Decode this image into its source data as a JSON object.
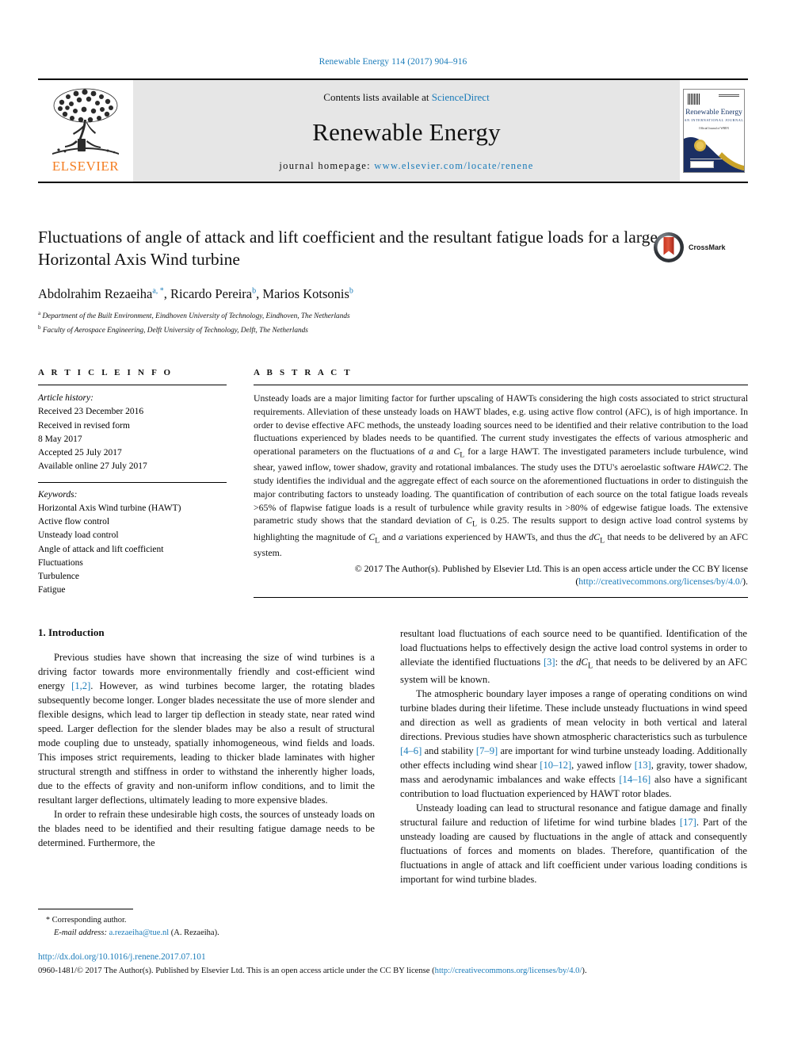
{
  "running_head": "Renewable Energy 114 (2017) 904–916",
  "masthead": {
    "contents_prefix": "Contents lists available at ",
    "contents_link": "ScienceDirect",
    "journal_name": "Renewable Energy",
    "homepage_prefix": "journal homepage: ",
    "homepage_url": "www.elsevier.com/locate/renene",
    "publisher": "ELSEVIER",
    "cover": {
      "title": "Renewable Energy",
      "subtitle": "AN INTERNATIONAL JOURNAL",
      "line3": "Official Journal of WREN"
    }
  },
  "article": {
    "title": "Fluctuations of angle of attack and lift coefficient and the resultant fatigue loads for a large Horizontal Axis Wind turbine",
    "authors": [
      {
        "name": "Abdolrahim Rezaeiha",
        "marks": "a, *"
      },
      {
        "name": "Ricardo Pereira",
        "marks": "b"
      },
      {
        "name": "Marios Kotsonis",
        "marks": "b"
      }
    ],
    "affiliations": [
      {
        "mark": "a",
        "text": "Department of the Built Environment, Eindhoven University of Technology, Eindhoven, The Netherlands"
      },
      {
        "mark": "b",
        "text": "Faculty of Aerospace Engineering, Delft University of Technology, Delft, The Netherlands"
      }
    ],
    "crossmark_label": "CrossMark"
  },
  "article_info": {
    "heading": "A R T I C L E   I N F O",
    "history_title": "Article history:",
    "history": [
      "Received 23 December 2016",
      "Received in revised form",
      "8 May 2017",
      "Accepted 25 July 2017",
      "Available online 27 July 2017"
    ],
    "keywords_title": "Keywords:",
    "keywords": [
      "Horizontal Axis Wind turbine (HAWT)",
      "Active flow control",
      "Unsteady load control",
      "Angle of attack and lift coefficient",
      "Fluctuations",
      "Turbulence",
      "Fatigue"
    ]
  },
  "abstract": {
    "heading": "A B S T R A C T",
    "paragraph_1": "Unsteady loads are a major limiting factor for further upscaling of HAWTs considering the high costs associated to strict structural requirements. Alleviation of these unsteady loads on HAWT blades, e.g. using active flow control (AFC), is of high importance. In order to devise effective AFC methods, the unsteady loading sources need to be identified and their relative contribution to the load fluctuations experienced by blades needs to be quantified. The current study investigates the effects of various atmospheric and operational parameters on the fluctuations of ",
    "frag_alpha": "a",
    "frag_and": " and ",
    "frag_cl": "C",
    "frag_cl_sub": "L",
    "paragraph_2": " for a large HAWT. The investigated parameters include turbulence, wind shear, yawed inflow, tower shadow, gravity and rotational imbalances. The study uses the DTU's aeroelastic software ",
    "frag_hawc2": "HAWC2",
    "paragraph_3": ". The study identifies the individual and the aggregate effect of each source on the aforementioned fluctuations in order to distinguish the major contributing factors to unsteady loading. The quantification of contribution of each source on the total fatigue loads reveals >65% of flapwise fatigue loads is a result of turbulence while gravity results in >80% of edgewise fatigue loads. The extensive parametric study shows that the standard deviation of ",
    "paragraph_4": " is 0.25. The results support to design active load control systems by highlighting the magnitude of ",
    "paragraph_5": " and ",
    "paragraph_6": " variations experienced by HAWTs, and thus the ",
    "frag_dcl": "dC",
    "paragraph_7": " that needs to be delivered by an AFC system.",
    "copyright_prefix": "© 2017 The Author(s). Published by Elsevier Ltd. This is an open access article under the CC BY license ",
    "license_open": "(",
    "license_url": "http://creativecommons.org/licenses/by/4.0/",
    "license_close": ")."
  },
  "introduction": {
    "heading": "1. Introduction",
    "left_paragraphs": [
      "Previous studies have shown that increasing the size of wind turbines is a driving factor towards more environmentally friendly and cost-efficient wind energy [1,2]. However, as wind turbines become larger, the rotating blades subsequently become longer. Longer blades necessitate the use of more slender and flexible designs, which lead to larger tip deflection in steady state, near rated wind speed. Larger deflection for the slender blades may be also a result of structural mode coupling due to unsteady, spatially inhomogeneous, wind fields and loads. This imposes strict requirements, leading to thicker blade laminates with higher structural strength and stiffness in order to withstand the inherently higher loads, due to the effects of gravity and non-uniform inflow conditions, and to limit the resultant larger deflections, ultimately leading to more expensive blades.",
      "In order to refrain these undesirable high costs, the sources of unsteady loads on the blades need to be identified and their resulting fatigue damage needs to be determined. Furthermore, the"
    ],
    "right_paragraphs": [
      "resultant load fluctuations of each source need to be quantified. Identification of the load fluctuations helps to effectively design the active load control systems in order to alleviate the identified fluctuations [3]: the dCL that needs to be delivered by an AFC system will be known.",
      "The atmospheric boundary layer imposes a range of operating conditions on wind turbine blades during their lifetime. These include unsteady fluctuations in wind speed and direction as well as gradients of mean velocity in both vertical and lateral directions. Previous studies have shown atmospheric characteristics such as turbulence [4–6] and stability [7–9] are important for wind turbine unsteady loading. Additionally other effects including wind shear [10–12], yawed inflow [13], gravity, tower shadow, mass and aerodynamic imbalances and wake effects [14–16] also have a significant contribution to load fluctuation experienced by HAWT rotor blades.",
      "Unsteady loading can lead to structural resonance and fatigue damage and finally structural failure and reduction of lifetime for wind turbine blades [17]. Part of the unsteady loading are caused by fluctuations in the angle of attack and consequently fluctuations of forces and moments on blades. Therefore, quantification of the fluctuations in angle of attack and lift coefficient under various loading conditions is important for wind turbine blades."
    ],
    "citations": {
      "c12": "[1,2]",
      "c3": "[3]",
      "c46": "[4–6]",
      "c79": "[7–9]",
      "c1012": "[10–12]",
      "c13": "[13]",
      "c1416": "[14–16]",
      "c17": "[17]"
    }
  },
  "footnote": {
    "star": "*",
    "corresponding": "Corresponding author.",
    "email_label": "E-mail address:",
    "email": "a.rezaeiha@tue.nl",
    "email_owner": "(A. Rezaeiha)."
  },
  "page_footer": {
    "doi": "http://dx.doi.org/10.1016/j.renene.2017.07.101",
    "issn_line_prefix": "0960-1481/© 2017 The Author(s). Published by Elsevier Ltd. This is an open access article under the CC BY license (",
    "issn_license_url": "http://creativecommons.org/licenses/by/4.0/",
    "issn_line_suffix": ")."
  },
  "colors": {
    "link_blue": "#1a7bb9",
    "elsevier_orange": "#f47c20",
    "masthead_gray": "#e6e6e6",
    "cover_navy": "#1b2f63",
    "cover_gold": "#c9a227"
  }
}
